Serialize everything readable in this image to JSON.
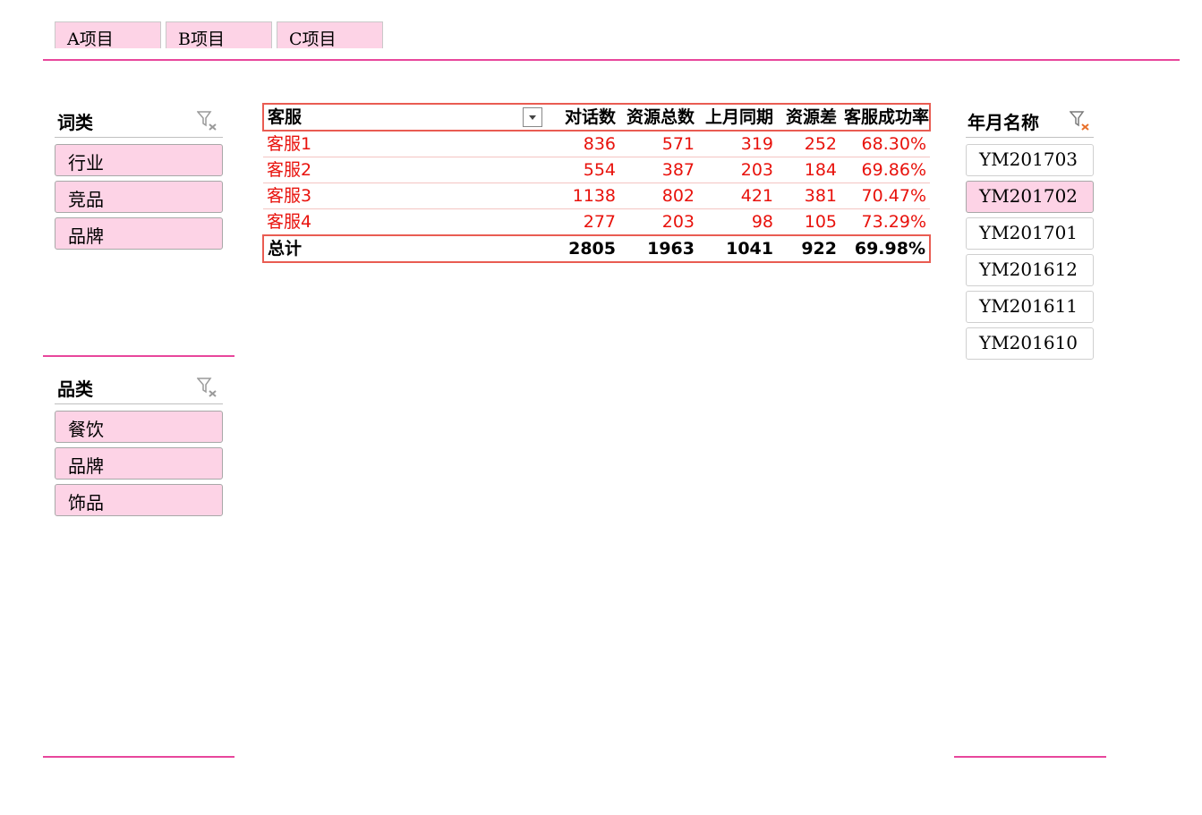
{
  "tabs": [
    "A项目",
    "B项目",
    "C项目"
  ],
  "slicer_category": {
    "title": "词类",
    "items": [
      "行业",
      "竞品",
      "品牌"
    ]
  },
  "slicer_product": {
    "title": "品类",
    "items": [
      "餐饮",
      "品牌",
      "饰品"
    ]
  },
  "slicer_month": {
    "title": "年月名称",
    "items": [
      "YM201703",
      "YM201702",
      "YM201701",
      "YM201612",
      "YM201611",
      "YM201610"
    ],
    "selected": "YM201702"
  },
  "pivot": {
    "headers": [
      "客服",
      "对话数",
      "资源总数",
      "上月同期",
      "资源差",
      "客服成功率"
    ],
    "rows": [
      [
        "客服1",
        "836",
        "571",
        "319",
        "252",
        "68.30%"
      ],
      [
        "客服2",
        "554",
        "387",
        "203",
        "184",
        "69.86%"
      ],
      [
        "客服3",
        "1138",
        "802",
        "421",
        "381",
        "70.47%"
      ],
      [
        "客服4",
        "277",
        "203",
        "98",
        "105",
        "73.29%"
      ]
    ],
    "total": [
      "总计",
      "2805",
      "1963",
      "1041",
      "922",
      "69.98%"
    ]
  },
  "colors": {
    "accent": "#e8479c",
    "slicer_fill": "#fdd3e6",
    "value_red": "#e8120c",
    "table_border": "#e95c52"
  }
}
